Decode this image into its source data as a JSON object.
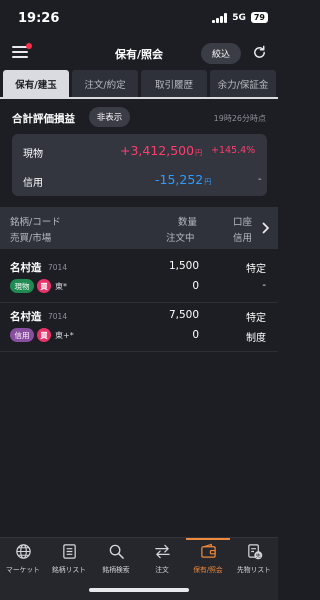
{
  "status_bar": {
    "time": "19:26",
    "network": "5G",
    "battery": "79"
  },
  "header": {
    "title": "保有/照会",
    "filter_label": "絞込"
  },
  "tabs": [
    {
      "label": "保有/建玉",
      "active": true
    },
    {
      "label": "注文/約定",
      "active": false
    },
    {
      "label": "取引履歴",
      "active": false
    },
    {
      "label": "余力/保証金",
      "active": false
    }
  ],
  "summary": {
    "title": "合計評価損益",
    "hide_label": "非表示",
    "update_time": "19時26分時点",
    "rows": [
      {
        "label": "現物",
        "value": "+3,412,500",
        "unit": "円",
        "pct": "+145.4%"
      },
      {
        "label": "信用",
        "value": "-15,252",
        "unit": "円",
        "pct": "-"
      }
    ]
  },
  "list_header": {
    "col1_line1": "銘柄/コード",
    "col1_line2": "売買/市場",
    "col2_line1": "数量",
    "col2_line2": "注文中",
    "col3_line1": "口座",
    "col3_line2": "信用"
  },
  "holdings": [
    {
      "name": "名村造",
      "code": "7014",
      "type": "現物",
      "side": "買",
      "market": "東*",
      "quantity": "1,500",
      "pending": "0",
      "account": "特定",
      "credit": "-"
    },
    {
      "name": "名村造",
      "code": "7014",
      "type": "信用",
      "side": "買",
      "market": "東+*",
      "quantity": "7,500",
      "pending": "0",
      "account": "特定",
      "credit": "制度"
    }
  ],
  "bottom_nav": [
    {
      "label": "マーケット",
      "icon": "globe-icon"
    },
    {
      "label": "銘柄リスト",
      "icon": "list-icon"
    },
    {
      "label": "銘柄検索",
      "icon": "search-icon"
    },
    {
      "label": "注文",
      "icon": "order-arrows-icon"
    },
    {
      "label": "保有/照会",
      "icon": "wallet-icon",
      "active": true
    },
    {
      "label": "先物リスト",
      "icon": "futures-list-icon"
    }
  ],
  "colors": {
    "positive": "#ff3d6e",
    "negative": "#2f9bff",
    "accent": "#f08a3c",
    "background": "#1c1e24"
  }
}
